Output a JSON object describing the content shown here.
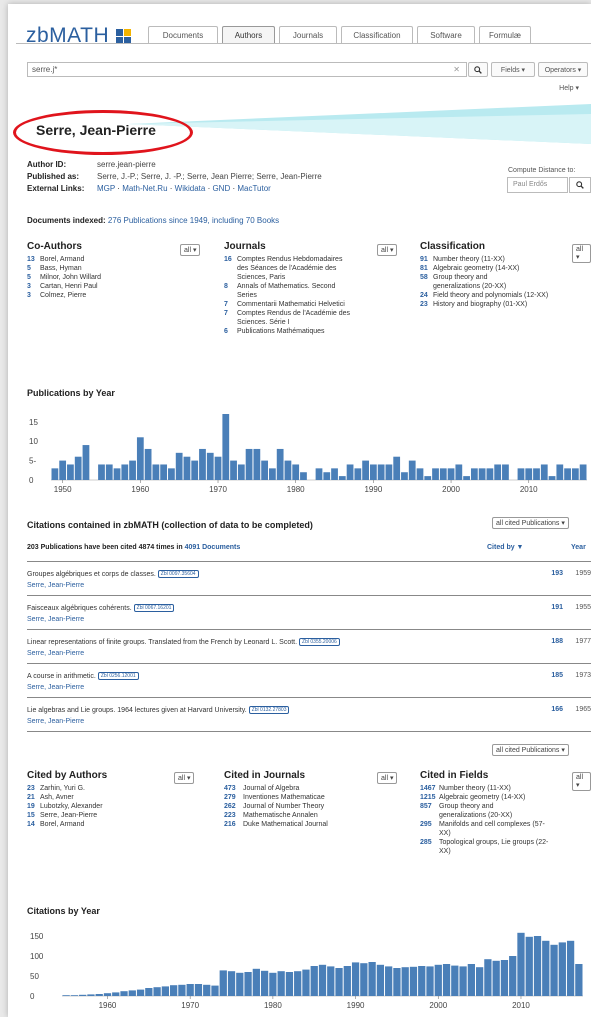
{
  "header": {
    "logo": "zbMATH",
    "tabs": [
      "Documents",
      "Authors",
      "Journals",
      "Classification",
      "Software",
      "Formulæ"
    ],
    "active_tab": "Authors",
    "search_value": "serre.j*",
    "fields_label": "Fields ▾",
    "operators_label": "Operators ▾",
    "help_label": "Help ▾"
  },
  "author": {
    "name": "Serre, Jean-Pierre",
    "id_label": "Author ID:",
    "id_value": "serre.jean-pierre",
    "published_label": "Published as:",
    "published_value": "Serre, J.-P.; Serre, J. -P.; Serre, Jean Pierre; Serre, Jean-Pierre",
    "links_label": "External Links:",
    "links": [
      "MGP",
      "Math-Net.Ru",
      "Wikidata",
      "GND",
      "MacTutor"
    ],
    "compute_label": "Compute Distance to:",
    "compute_placeholder": "Paul Erdős",
    "docs_label": "Documents indexed:",
    "docs_value": "276 Publications since 1949, including 70 Books"
  },
  "coauthors": {
    "title": "Co-Authors",
    "drop": "all ▾",
    "items": [
      {
        "n": "13",
        "t": "Borel, Armand"
      },
      {
        "n": "5",
        "t": "Bass, Hyman"
      },
      {
        "n": "5",
        "t": "Milnor, John Willard"
      },
      {
        "n": "3",
        "t": "Cartan, Henri Paul"
      },
      {
        "n": "3",
        "t": "Colmez, Pierre"
      }
    ]
  },
  "journals": {
    "title": "Journals",
    "drop": "all ▾",
    "items": [
      {
        "n": "16",
        "t": [
          "Comptes Rendus Hebdomadaires",
          "des Séances de l'Académie des",
          "Sciences, Paris"
        ]
      },
      {
        "n": "8",
        "t": [
          "Annals of Mathematics. Second",
          "Series"
        ]
      },
      {
        "n": "7",
        "t": [
          "Commentarii Mathematici Helvetici"
        ]
      },
      {
        "n": "7",
        "t": [
          "Comptes Rendus de l'Académie des",
          "Sciences. Série I"
        ]
      },
      {
        "n": "6",
        "t": [
          "Publications Mathématiques"
        ]
      }
    ]
  },
  "classification": {
    "title": "Classification",
    "drop": "all ▾",
    "items": [
      {
        "n": "91",
        "t": [
          "Number theory (11-XX)"
        ]
      },
      {
        "n": "81",
        "t": [
          "Algebraic geometry (14-XX)"
        ]
      },
      {
        "n": "58",
        "t": [
          "Group theory and",
          "generalizations (20-XX)"
        ]
      },
      {
        "n": "24",
        "t": [
          "Field theory and polynomials (12-XX)"
        ]
      },
      {
        "n": "23",
        "t": [
          "History and biography (01-XX)"
        ]
      }
    ]
  },
  "pubs_by_year": {
    "title": "Publications by Year",
    "yticks": [
      "15",
      "10",
      "5-",
      "0"
    ],
    "xticks": [
      "1950",
      "1960",
      "1970",
      "1980",
      "1990",
      "2000",
      "2010"
    ]
  },
  "citations": {
    "title": "Citations contained in zbMATH (collection of data to be completed)",
    "summary_pre": "203 Publications have been cited 4874 times in",
    "summary_link": "4091 Documents",
    "drop": "all cited Publications ▾",
    "cited_by_head": "Cited by ▼",
    "year_head": "Year",
    "entries": [
      {
        "title": "Groupes algébriques et corps de classes.",
        "zbl": "Zbl 0097.35604",
        "author": "Serre, Jean-Pierre",
        "count": "193",
        "year": "1959"
      },
      {
        "title": "Faisceaux algébriques cohérents.",
        "zbl": "Zbl 0067.16201",
        "author": "Serre, Jean-Pierre",
        "count": "191",
        "year": "1955"
      },
      {
        "title": "Linear representations of finite groups. Translated from the French by Leonard L. Scott.",
        "zbl": "Zbl 0355.20006",
        "author": "Serre, Jean-Pierre",
        "count": "188",
        "year": "1977"
      },
      {
        "title": "A course in arithmetic.",
        "zbl": "Zbl 0256.12001",
        "author": "Serre, Jean-Pierre",
        "count": "185",
        "year": "1973"
      },
      {
        "title": "Lie algebras and Lie groups. 1964 lectures given at Harvard University.",
        "zbl": "Zbl 0132.27803",
        "author": "Serre, Jean-Pierre",
        "count": "166",
        "year": "1965"
      }
    ],
    "bottom_drop": "all cited Publications ▾"
  },
  "cited_authors": {
    "title": "Cited by Authors",
    "drop": "all ▾",
    "items": [
      {
        "n": "23",
        "t": [
          "Zarhin, Yuri G."
        ]
      },
      {
        "n": "21",
        "t": [
          "Ash, Avner"
        ]
      },
      {
        "n": "19",
        "t": [
          "Lubotzky, Alexander"
        ]
      },
      {
        "n": "15",
        "t": [
          "Serre, Jean-Pierre"
        ]
      },
      {
        "n": "14",
        "t": [
          "Borel, Armand"
        ]
      }
    ]
  },
  "cited_journals": {
    "title": "Cited in Journals",
    "drop": "all ▾",
    "items": [
      {
        "n": "473",
        "t": [
          "Journal of Algebra"
        ]
      },
      {
        "n": "279",
        "t": [
          "Inventiones Mathematicae"
        ]
      },
      {
        "n": "262",
        "t": [
          "Journal of Number Theory"
        ]
      },
      {
        "n": "223",
        "t": [
          "Mathematische Annalen"
        ]
      },
      {
        "n": "216",
        "t": [
          "Duke Mathematical Journal"
        ]
      }
    ]
  },
  "cited_fields": {
    "title": "Cited in Fields",
    "drop": "all ▾",
    "items": [
      {
        "n": "1467",
        "t": [
          "Number theory (11-XX)"
        ]
      },
      {
        "n": "1215",
        "t": [
          "Algebraic geometry (14-XX)"
        ]
      },
      {
        "n": "857",
        "t": [
          "Group theory and",
          "generalizations (20-XX)"
        ]
      },
      {
        "n": "295",
        "t": [
          "Manifolds and cell complexes (57-",
          "XX)"
        ]
      },
      {
        "n": "285",
        "t": [
          "Topological groups, Lie groups (22-",
          "XX)"
        ]
      }
    ]
  },
  "citations_by_year": {
    "title": "Citations by Year",
    "yticks": [
      "150",
      "100",
      "50",
      "0"
    ],
    "xticks": [
      "1960",
      "1970",
      "1980",
      "1990",
      "2000",
      "2010"
    ]
  },
  "chart_data": [
    {
      "type": "bar",
      "title": "Publications by Year",
      "ylim": [
        0,
        17
      ],
      "bar_color": "#4a7fb8",
      "x": [
        1949,
        1950,
        1951,
        1952,
        1953,
        1954,
        1955,
        1956,
        1957,
        1958,
        1959,
        1960,
        1961,
        1962,
        1963,
        1964,
        1965,
        1966,
        1967,
        1968,
        1969,
        1970,
        1971,
        1972,
        1973,
        1974,
        1975,
        1976,
        1977,
        1978,
        1979,
        1980,
        1981,
        1982,
        1983,
        1984,
        1985,
        1986,
        1987,
        1988,
        1989,
        1990,
        1991,
        1992,
        1993,
        1994,
        1995,
        1996,
        1997,
        1998,
        1999,
        2000,
        2001,
        2002,
        2003,
        2004,
        2005,
        2006,
        2007,
        2008,
        2009,
        2010,
        2011,
        2012,
        2013,
        2014,
        2015,
        2016,
        2017
      ],
      "values": [
        3,
        5,
        4,
        6,
        9,
        0,
        4,
        4,
        3,
        4,
        5,
        11,
        8,
        4,
        4,
        3,
        7,
        6,
        5,
        8,
        7,
        6,
        17,
        5,
        4,
        8,
        8,
        5,
        3,
        8,
        5,
        4,
        2,
        0,
        3,
        2,
        3,
        1,
        4,
        3,
        5,
        4,
        4,
        4,
        6,
        2,
        5,
        3,
        1,
        3,
        3,
        3,
        4,
        1,
        3,
        3,
        3,
        4,
        4,
        0,
        3,
        3,
        3,
        4,
        1,
        4,
        3,
        3,
        4
      ],
      "xticks": [
        "1950",
        "1960",
        "1970",
        "1980",
        "1990",
        "2000",
        "2010"
      ]
    },
    {
      "type": "bar",
      "title": "Citations by Year",
      "ylim": [
        0,
        170
      ],
      "bar_color": "#4a7fb8",
      "x": [
        1955,
        1956,
        1957,
        1958,
        1959,
        1960,
        1961,
        1962,
        1963,
        1964,
        1965,
        1966,
        1967,
        1968,
        1969,
        1970,
        1971,
        1972,
        1973,
        1974,
        1975,
        1976,
        1977,
        1978,
        1979,
        1980,
        1981,
        1982,
        1983,
        1984,
        1985,
        1986,
        1987,
        1988,
        1989,
        1990,
        1991,
        1992,
        1993,
        1994,
        1995,
        1996,
        1997,
        1998,
        1999,
        2000,
        2001,
        2002,
        2003,
        2004,
        2005,
        2006,
        2007,
        2008,
        2009,
        2010,
        2011,
        2012,
        2013,
        2014,
        2015,
        2016,
        2017
      ],
      "values": [
        2,
        2,
        3,
        4,
        5,
        7,
        9,
        12,
        14,
        16,
        20,
        22,
        24,
        27,
        28,
        30,
        30,
        28,
        26,
        64,
        62,
        58,
        60,
        68,
        63,
        58,
        62,
        60,
        62,
        66,
        75,
        78,
        74,
        70,
        75,
        84,
        82,
        85,
        78,
        74,
        70,
        72,
        73,
        75,
        74,
        78,
        80,
        76,
        74,
        80,
        72,
        92,
        88,
        90,
        100,
        158,
        148,
        150,
        138,
        128,
        134,
        138,
        80
      ]
    }
  ]
}
